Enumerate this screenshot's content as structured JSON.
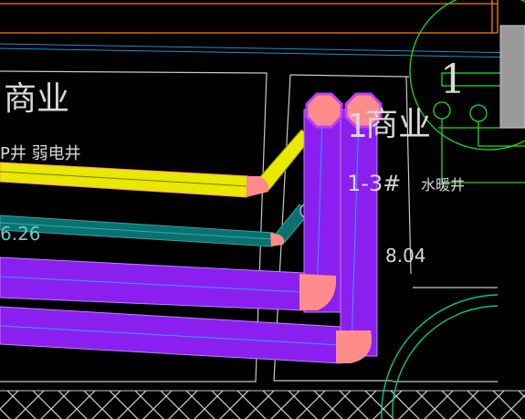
{
  "drawing": {
    "labels": {
      "room_left": "商业",
      "room_left_prefix": "P",
      "shaft_left": "P井 弱电井",
      "dim_left": "6.26",
      "room_right": "商业",
      "room_right_prefix": "1",
      "shaft_right_code": "1-3#",
      "shaft_right_name": "水暖井",
      "dim_right": "8.04",
      "axis_mark": "1"
    },
    "colors": {
      "background": "#000000",
      "wall": "#c8c8c8",
      "yellow_pipe": "#e8e800",
      "teal_pipe": "#0a7070",
      "purple_pipe": "#8a1ff0",
      "fitting": "#ff8b8b",
      "orange_line": "#ff8000",
      "green_circle": "#1fdc1f",
      "cyan_axis": "#1f8fd0",
      "teal_arc": "#00c88c"
    }
  }
}
